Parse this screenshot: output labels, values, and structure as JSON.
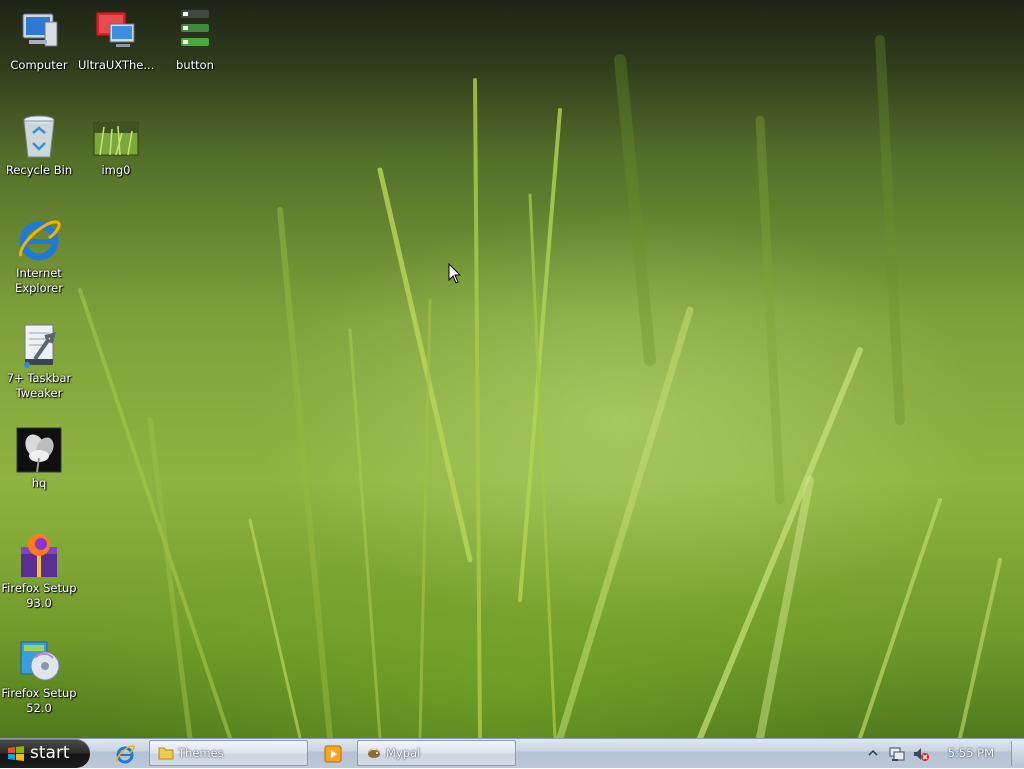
{
  "desktop": {
    "icons": [
      {
        "label": "Computer",
        "icon": "computer-icon"
      },
      {
        "label": "UltraUXThe...",
        "icon": "ultrauxtheme-patcher-icon"
      },
      {
        "label": "button",
        "icon": "button-image-icon"
      },
      {
        "label": "Recycle Bin",
        "icon": "recycle-bin-icon"
      },
      {
        "label": "img0",
        "icon": "image-file-icon"
      },
      {
        "label": "Internet Explorer",
        "icon": "internet-explorer-icon"
      },
      {
        "label": "7+ Taskbar Tweaker",
        "icon": "taskbar-tweaker-icon"
      },
      {
        "label": "hq",
        "icon": "flower-image-icon"
      },
      {
        "label": "Firefox Setup 93.0",
        "icon": "firefox-installer-icon"
      },
      {
        "label": "Firefox Setup 52.0",
        "icon": "setup-installer-icon"
      }
    ]
  },
  "taskbar": {
    "start_label": "start",
    "quick_launch": [
      {
        "icon": "internet-explorer-icon"
      },
      {
        "icon": "media-player-icon"
      }
    ],
    "tasks": [
      {
        "label": "Themes",
        "icon": "folder-icon"
      },
      {
        "label": "Mypal",
        "icon": "mypal-browser-icon"
      }
    ],
    "tray": {
      "icons": [
        "show-hidden-icons-chevron",
        "network-icon",
        "volume-muted-icon"
      ],
      "clock": "5:55 PM"
    }
  },
  "colors": {
    "taskbar_bg": "#c9d4e2",
    "start_bg": "#1f1f1f",
    "wallpaper_green": "#8fb342"
  }
}
